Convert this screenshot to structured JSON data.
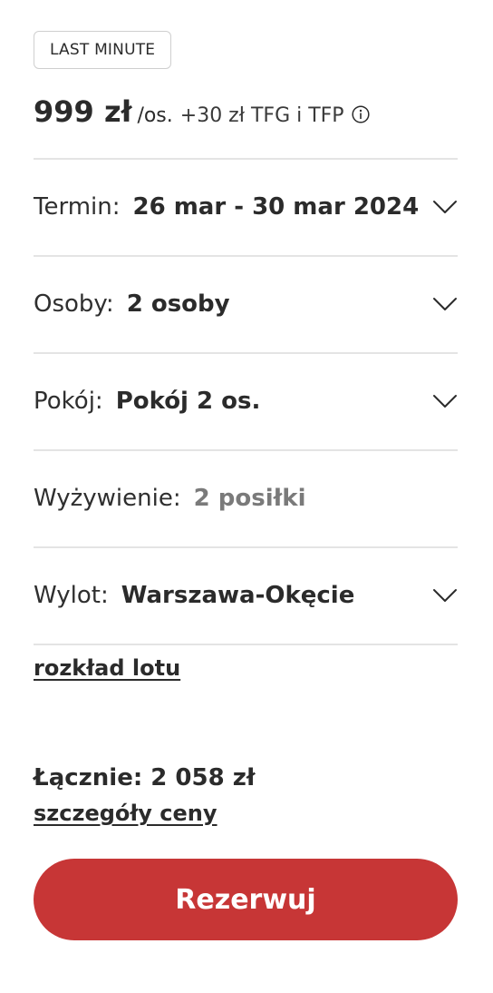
{
  "badge": "LAST MINUTE",
  "price": {
    "amount": "999 zł",
    "per": "/os.",
    "fees": "+30 zł TFG i TFP",
    "info_icon": "info-circle-icon"
  },
  "rows": {
    "term": {
      "label": "Termin:",
      "value": "26 mar - 30 mar 2024",
      "icon": "chevron-down-icon"
    },
    "persons": {
      "label": "Osoby:",
      "value": "2 osoby",
      "icon": "chevron-down-icon"
    },
    "room": {
      "label": "Pokój:",
      "value": "Pokój 2 os.",
      "icon": "chevron-down-icon"
    },
    "board": {
      "label": "Wyżywienie:",
      "value": "2 posiłki"
    },
    "departure": {
      "label": "Wylot:",
      "value": "Warszawa-Okęcie",
      "icon": "chevron-down-icon"
    }
  },
  "flight_schedule_link": "rozkład lotu",
  "total": "Łącznie: 2 058 zł",
  "price_details_link": "szczegóły ceny",
  "cta_label": "Rezerwuj",
  "colors": {
    "accent": "#c73636",
    "text": "#2b2b2b",
    "muted": "#7a7a7a",
    "divider": "#e4e4e4"
  }
}
